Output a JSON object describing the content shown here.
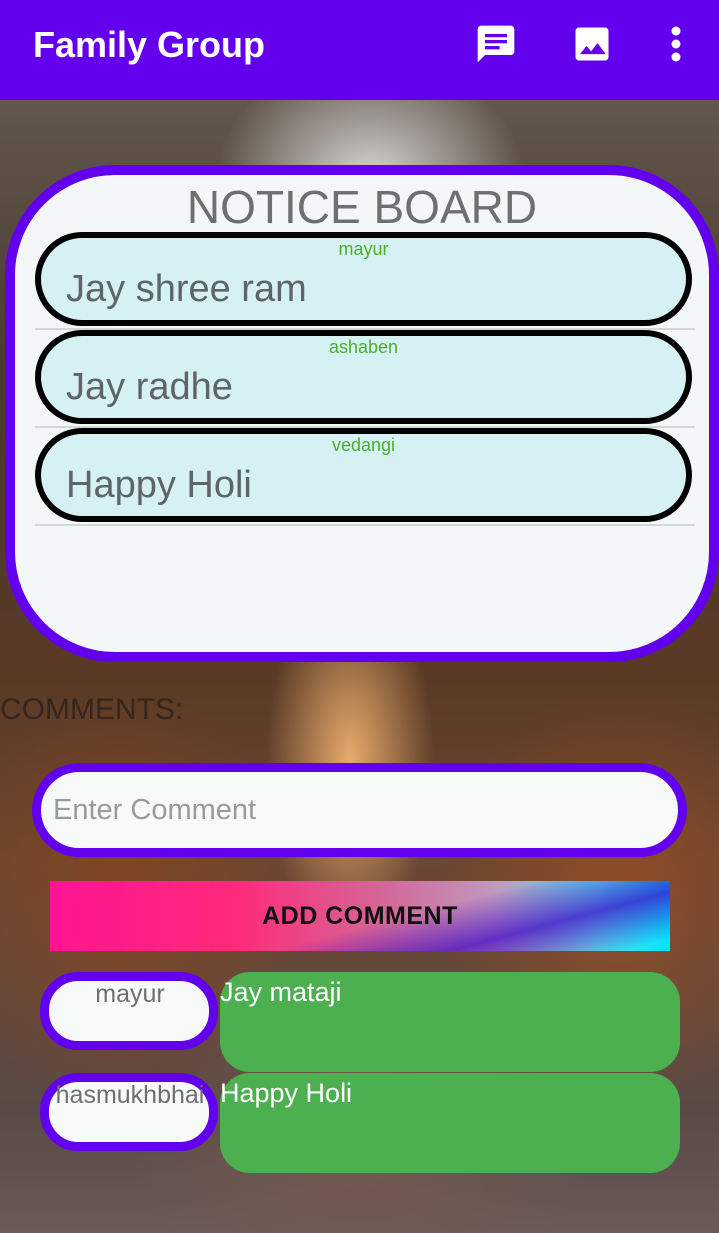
{
  "app_bar": {
    "title": "Family Group",
    "background": "#6200ee",
    "actions": [
      {
        "icon": "message-icon"
      },
      {
        "icon": "image-icon"
      },
      {
        "icon": "more-vert-icon"
      }
    ]
  },
  "notice_board": {
    "title": "NOTICE BOARD",
    "border_color": "#6200ee",
    "items": [
      {
        "author": "mayur",
        "text": "Jay shree ram"
      },
      {
        "author": "ashaben",
        "text": "Jay radhe"
      },
      {
        "author": "vedangi",
        "text": "Happy Holi"
      }
    ]
  },
  "comments": {
    "label": "COMMENTS:",
    "input_placeholder": "Enter Comment",
    "add_button_label": "ADD COMMENT",
    "items": [
      {
        "user": "mayur",
        "text": "Jay mataji"
      },
      {
        "user": "hasmukhbhai",
        "text": "Happy  Holi"
      }
    ],
    "bubble_color": "#4caf50"
  }
}
